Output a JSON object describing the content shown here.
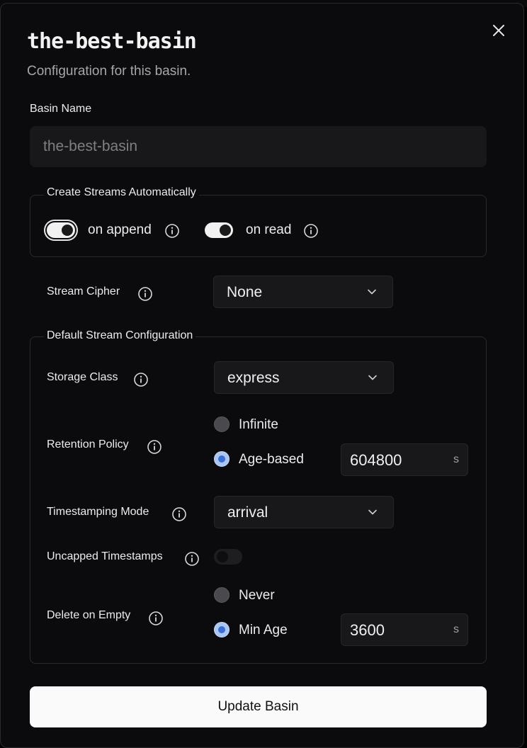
{
  "dialog": {
    "title": "the-best-basin",
    "subtitle": "Configuration for this basin."
  },
  "basin_name": {
    "label": "Basin Name",
    "value": "the-best-basin"
  },
  "create_streams": {
    "legend": "Create Streams Automatically",
    "on_append": {
      "label": "on append",
      "enabled": true
    },
    "on_read": {
      "label": "on read",
      "enabled": true
    }
  },
  "stream_cipher": {
    "label": "Stream Cipher",
    "value": "None"
  },
  "default_config": {
    "legend": "Default Stream Configuration",
    "storage_class": {
      "label": "Storage Class",
      "value": "express"
    },
    "retention_policy": {
      "label": "Retention Policy",
      "options": [
        "Infinite",
        "Age-based"
      ],
      "selected": "Age-based",
      "age_value": "604800",
      "age_unit": "s"
    },
    "timestamping_mode": {
      "label": "Timestamping Mode",
      "value": "arrival"
    },
    "uncapped_timestamps": {
      "label": "Uncapped Timestamps",
      "enabled": false
    },
    "delete_on_empty": {
      "label": "Delete on Empty",
      "options": [
        "Never",
        "Min Age"
      ],
      "selected": "Min Age",
      "min_age_value": "3600",
      "min_age_unit": "s"
    }
  },
  "submit": {
    "label": "Update Basin"
  },
  "colors": {
    "background": "#0b0b0d",
    "input": "#18181b",
    "accent": "#a9c6f5",
    "button": "#fafafa"
  },
  "icons": {
    "close": "close-icon",
    "info": "info-icon",
    "chevron": "chevron-down-icon"
  }
}
